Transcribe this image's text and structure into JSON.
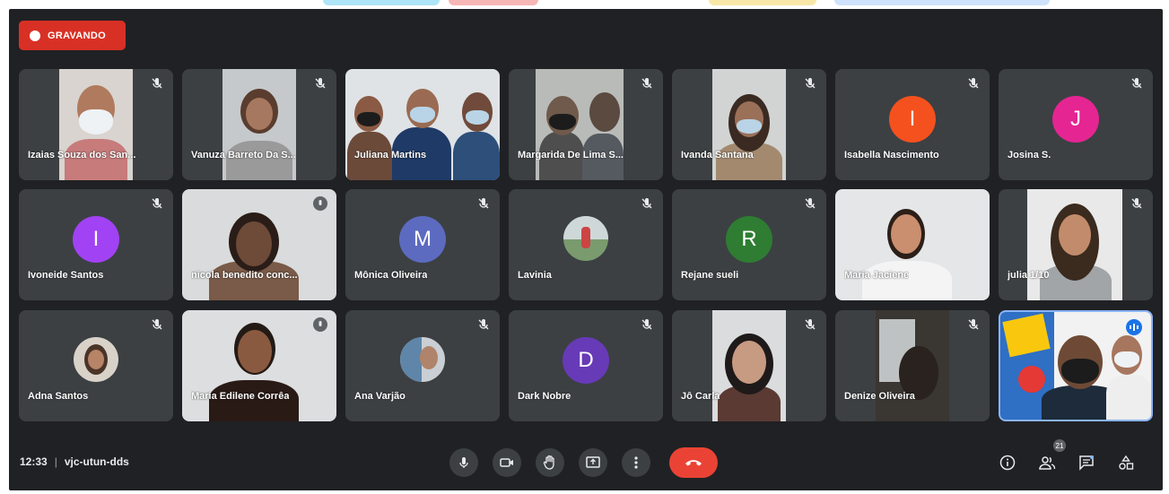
{
  "recording": {
    "label": "GRAVANDO"
  },
  "participants": [
    {
      "name": "Izaias Souza dos San..."
    },
    {
      "name": "Vanuza Barreto Da S..."
    },
    {
      "name": "Juliana Martins"
    },
    {
      "name": "Margarida De Lima S..."
    },
    {
      "name": "Ivanda Santana"
    },
    {
      "name": "Isabella Nascimento",
      "initial": "I",
      "color": "#f4511e"
    },
    {
      "name": "Josina S.",
      "initial": "J",
      "color": "#e52592"
    },
    {
      "name": "Ivoneide Santos",
      "initial": "I",
      "color": "#a142f4"
    },
    {
      "name": "nicola benedito conc..."
    },
    {
      "name": "Mônica Oliveira",
      "initial": "M",
      "color": "#5c6bc0"
    },
    {
      "name": "Lavinia"
    },
    {
      "name": "Rejane sueli",
      "initial": "R",
      "color": "#2e7d32"
    },
    {
      "name": "Maria Jaciene"
    },
    {
      "name": "julia 1/10"
    },
    {
      "name": "Adna Santos"
    },
    {
      "name": "Maria Edilene Corrêa"
    },
    {
      "name": "Ana Varjão"
    },
    {
      "name": "Dark Nobre",
      "initial": "D",
      "color": "#673ab7"
    },
    {
      "name": "Jô Carla"
    },
    {
      "name": "Denize Oliveira"
    },
    {
      "name": ""
    }
  ],
  "meeting": {
    "time": "12:33",
    "separator": "|",
    "code": "vjc-utun-dds"
  },
  "controls": {
    "mic": "mic-icon",
    "camera": "camera-icon",
    "raise_hand": "raise-hand-icon",
    "present": "present-screen-icon",
    "more": "more-options-icon",
    "end_call": "end-call-icon"
  },
  "side_controls": {
    "info": "info-icon",
    "people": "people-icon",
    "people_count": "21",
    "chat": "chat-icon",
    "activities": "activities-icon"
  },
  "colors": {
    "background": "#202124",
    "tile": "#3c4043",
    "recording": "#d93025",
    "end_call": "#ea4335",
    "selected_border": "#8ab4f8"
  }
}
